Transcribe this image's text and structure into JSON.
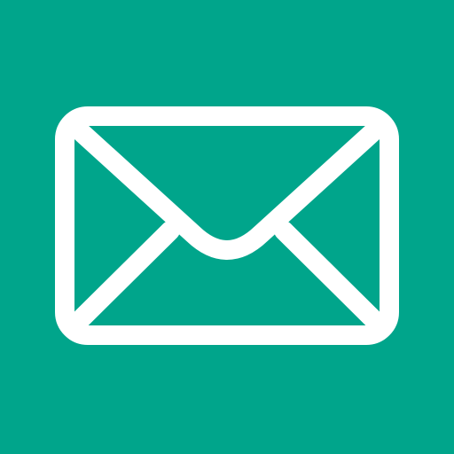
{
  "icon": {
    "name": "mail-envelope-icon",
    "background_color": "#00A58B",
    "glyph_color": "#FFFFFF"
  }
}
